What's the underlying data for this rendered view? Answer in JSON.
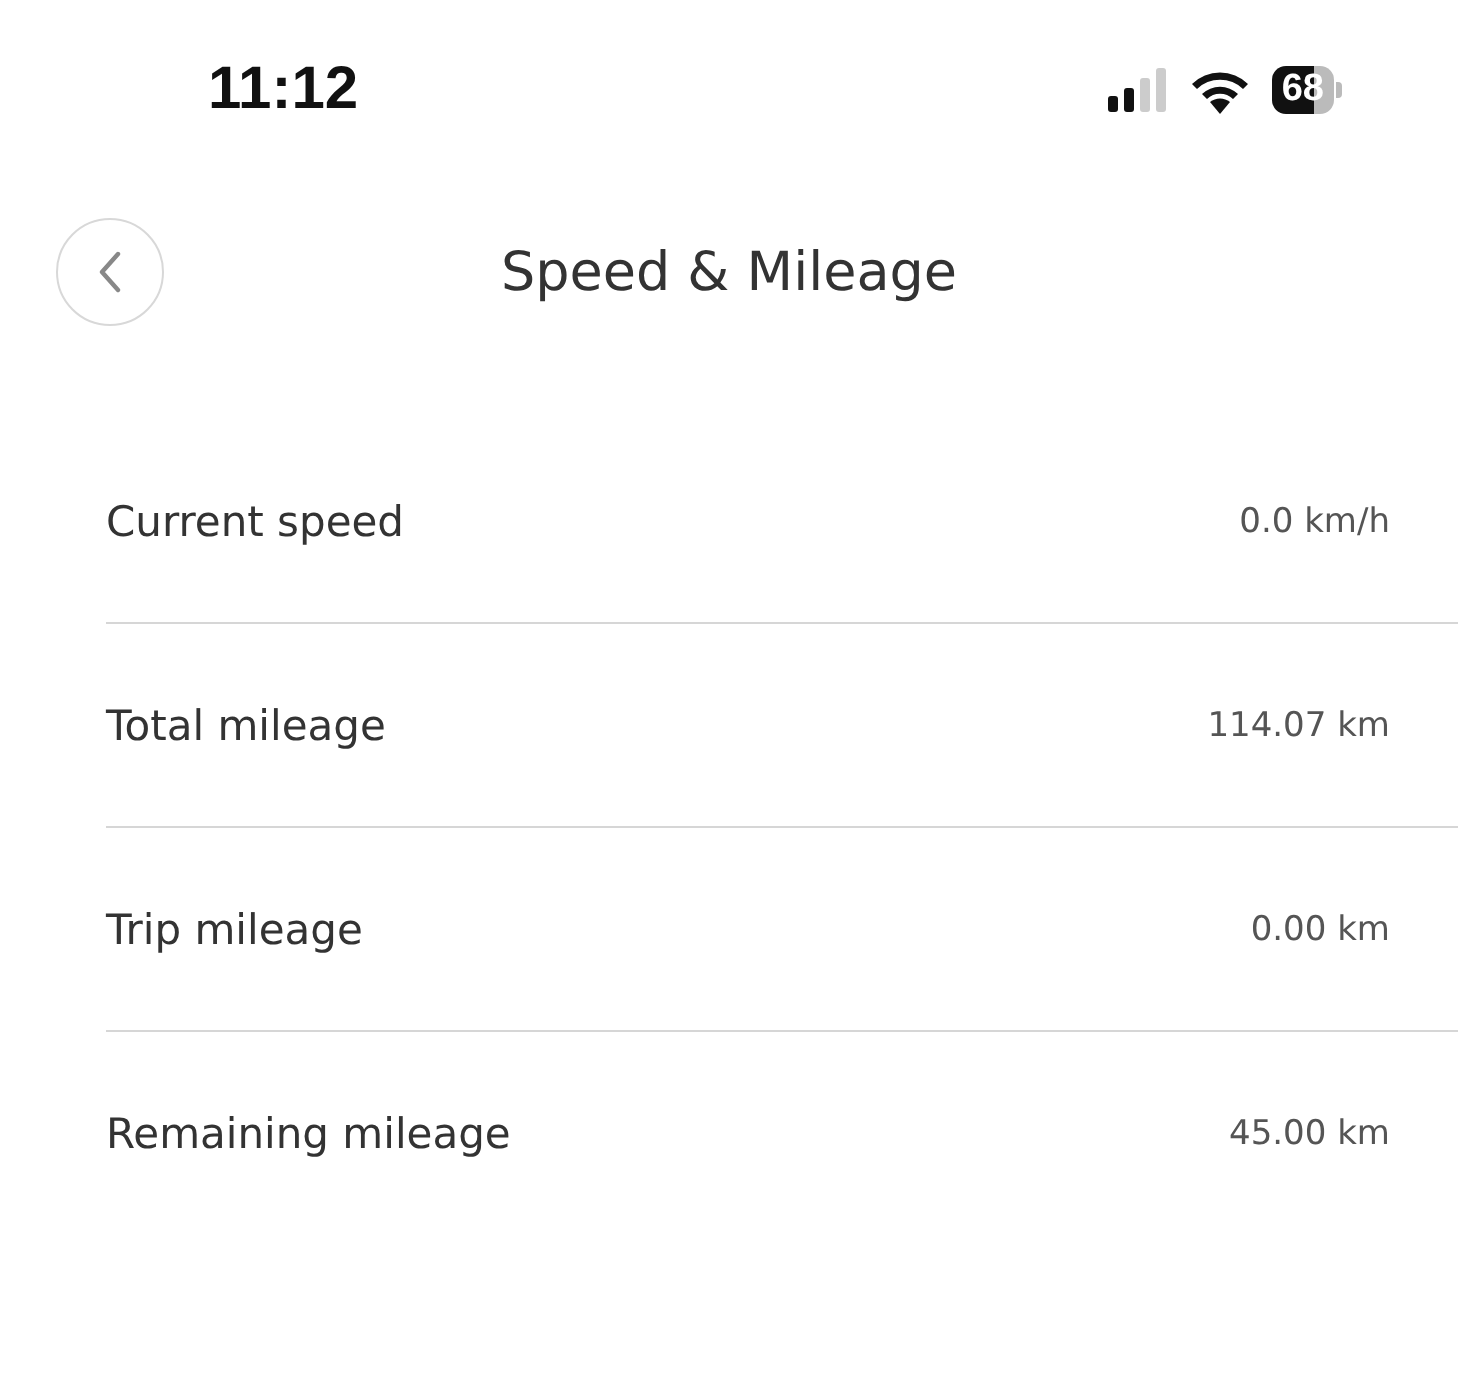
{
  "status_bar": {
    "time": "11:12",
    "battery": "68"
  },
  "header": {
    "title": "Speed & Mileage"
  },
  "rows": [
    {
      "label": "Current speed",
      "value": "0.0 km/h"
    },
    {
      "label": "Total mileage",
      "value": "114.07 km"
    },
    {
      "label": "Trip mileage",
      "value": "0.00 km"
    },
    {
      "label": "Remaining mileage",
      "value": "45.00 km"
    }
  ]
}
